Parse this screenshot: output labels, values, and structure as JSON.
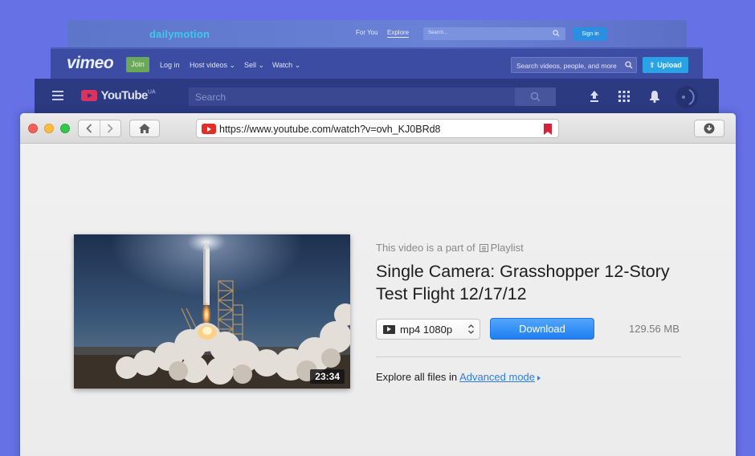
{
  "dailymotion": {
    "logo": "dailymotion",
    "nav_for_you": "For You",
    "nav_explore": "Explore",
    "search_placeholder": "Search...",
    "sign_in": "Sign in"
  },
  "vimeo": {
    "logo": "vimeo",
    "join": "Join",
    "log_in": "Log in",
    "host_videos": "Host videos",
    "sell": "Sell",
    "watch": "Watch",
    "search_placeholder": "Search videos, people, and more",
    "upload": "Upload"
  },
  "youtube_bg": {
    "logo": "YouTube",
    "region": "UA",
    "search_placeholder": "Search"
  },
  "browser": {
    "url": "https://www.youtube.com/watch?v=ovh_KJ0BRd8"
  },
  "video": {
    "playlist_prefix": "This video is a part of",
    "playlist_label": "Playlist",
    "title": "Single Camera: Grasshopper 12-Story Test Flight 12/17/12",
    "duration": "23:34",
    "format": "mp4 1080p",
    "download_label": "Download",
    "file_size": "129.56 MB",
    "explore_text": "Explore all files in",
    "advanced_mode_link": "Advanced mode"
  },
  "colors": {
    "background": "#6571e4",
    "download_button": "#2a86f5",
    "link": "#2f7de1"
  },
  "icons": {
    "back": "chevron-left-icon",
    "forward": "chevron-right-icon",
    "home": "home-icon",
    "bookmark": "bookmark-icon",
    "download": "download-circle-icon"
  }
}
